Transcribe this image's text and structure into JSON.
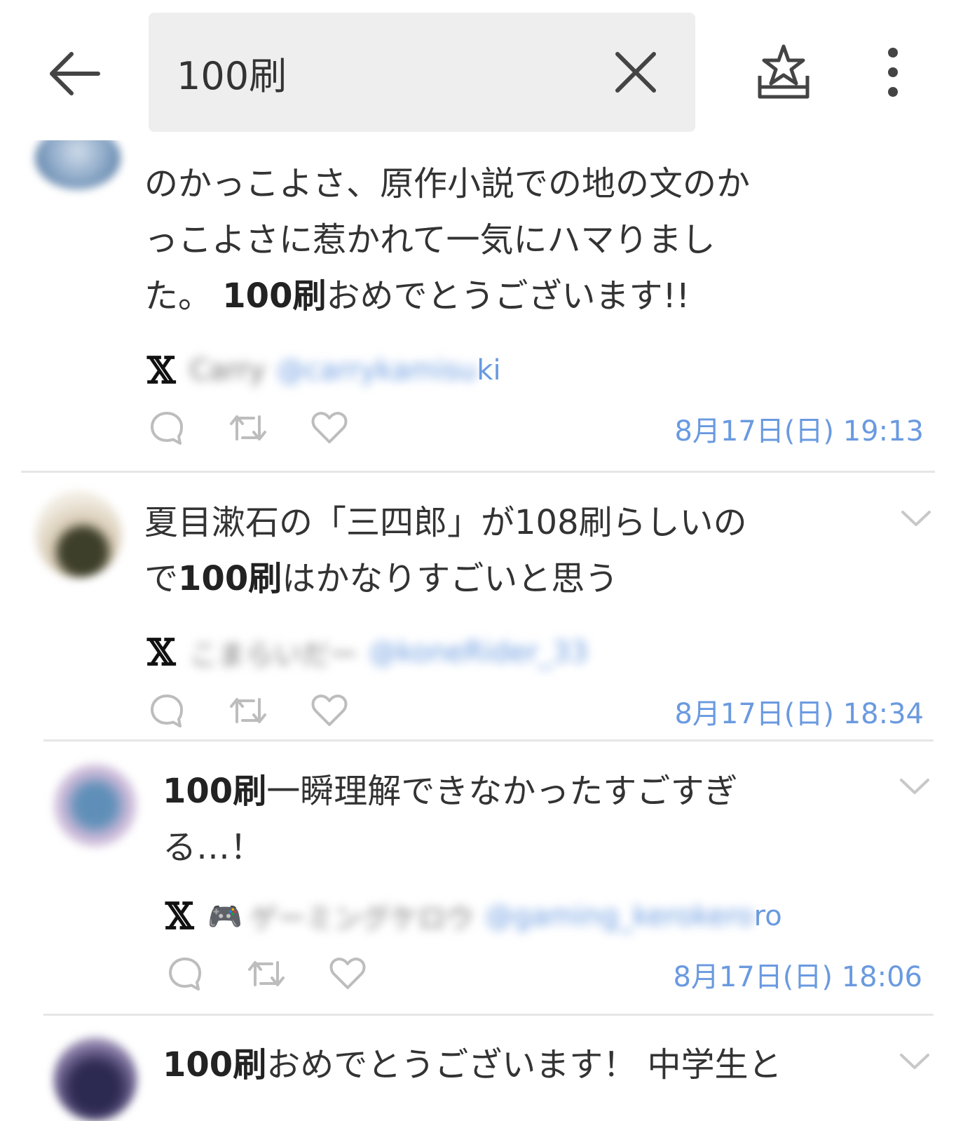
{
  "search": {
    "query": "100刷"
  },
  "posts": [
    {
      "lines": [
        [
          {
            "t": "のかっこよさ、原作小説での地の文のか"
          }
        ],
        [
          {
            "t": "っこよさに惹かれて一気にハマりまし"
          }
        ],
        [
          {
            "t": "た。 "
          },
          {
            "t": "100刷",
            "b": true
          },
          {
            "t": "おめでとうございます!!"
          }
        ]
      ],
      "author_name": "Carry",
      "handle_prefix": "@carrykamisu",
      "handle_suffix": "ki",
      "time": "8月17日(日) 19:13"
    },
    {
      "lines": [
        [
          {
            "t": "夏目漱石の「三四郎」が108刷らしいの"
          }
        ],
        [
          {
            "t": "で"
          },
          {
            "t": "100刷",
            "b": true
          },
          {
            "t": "はかなりすごいと思う"
          }
        ]
      ],
      "author_name": "こまらいだー",
      "handle_prefix": "@koneRider_33",
      "handle_suffix": "",
      "time": "8月17日(日) 18:34"
    },
    {
      "lines": [
        [
          {
            "t": "100刷",
            "b": true
          },
          {
            "t": "一瞬理解できなかったすごすぎ"
          }
        ],
        [
          {
            "t": "る…！"
          }
        ]
      ],
      "author_emoji": "🎮",
      "author_name": "ゲーミングケロウ",
      "handle_prefix": "@gaming_kerokero",
      "handle_suffix": "ro",
      "time": "8月17日(日) 18:06"
    },
    {
      "lines": [
        [
          {
            "t": "100刷",
            "b": true
          },
          {
            "t": "おめでとうございます！ 中学生と"
          }
        ]
      ]
    }
  ]
}
